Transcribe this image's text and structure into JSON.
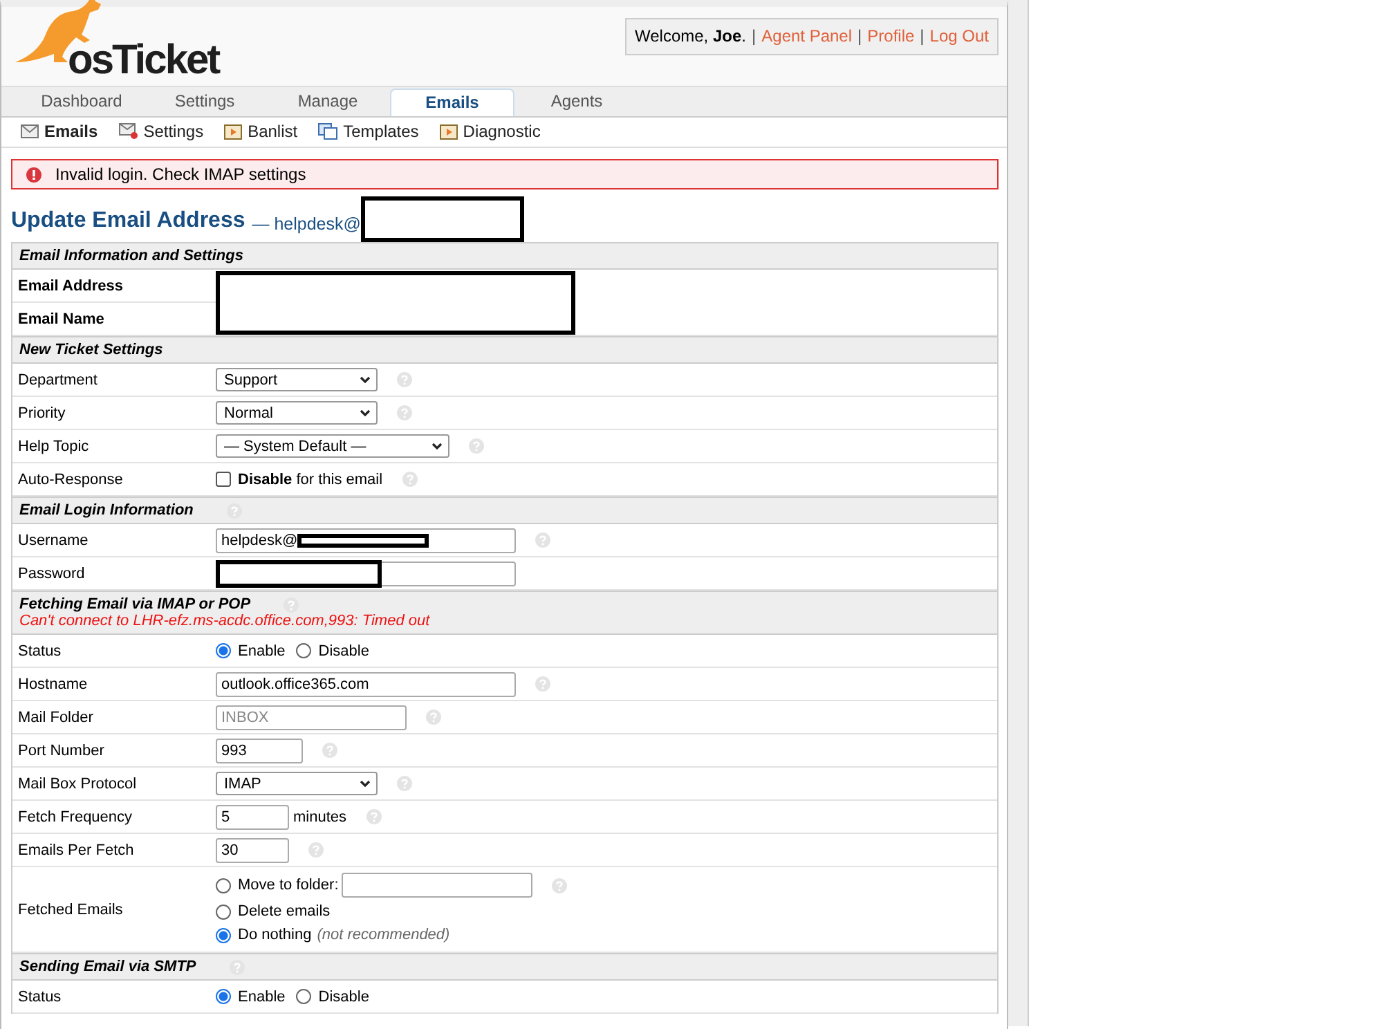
{
  "logo": {
    "text": "osTicket"
  },
  "user_bar": {
    "greeting": "Welcome, **Joe**.",
    "separator": "|",
    "links": [
      "Agent Panel",
      "Profile",
      "Log Out"
    ]
  },
  "tabs": [
    {
      "label": "Dashboard",
      "selected": false
    },
    {
      "label": "Settings",
      "selected": false
    },
    {
      "label": "Manage",
      "selected": false
    },
    {
      "label": "Emails",
      "selected": true
    },
    {
      "label": "Agents",
      "selected": false
    }
  ],
  "subnav": [
    {
      "label": "Emails",
      "selected": true
    },
    {
      "label": "Settings",
      "selected": false
    },
    {
      "label": "Banlist",
      "selected": false
    },
    {
      "label": "Templates",
      "selected": false
    },
    {
      "label": "Diagnostic",
      "selected": false
    }
  ],
  "alert": "Invalid login. Check IMAP settings",
  "page_title": {
    "title": "Update Email Address",
    "subtitle": "— helpdesk@",
    "redacted": true
  },
  "sections": [
    {
      "title": "Email Information and Settings",
      "help": false,
      "rows": [
        {
          "label": "Email Address",
          "bold": true,
          "control": {
            "kind": "redacted",
            "spans_next": true
          }
        },
        {
          "label": "Email Name",
          "bold": true
        }
      ]
    },
    {
      "title": "New Ticket Settings",
      "help": false,
      "rows": [
        {
          "label": "Department",
          "help": true,
          "control": {
            "kind": "select",
            "value": "Support"
          }
        },
        {
          "label": "Priority",
          "help": true,
          "control": {
            "kind": "select",
            "value": "Normal"
          }
        },
        {
          "label": "Help Topic",
          "help": true,
          "control": {
            "kind": "select",
            "value": "— System Default —"
          }
        },
        {
          "label": "Auto-Response",
          "help": true,
          "control": {
            "kind": "checkbox",
            "checked": false,
            "text": "**Disable** for this email"
          }
        }
      ]
    },
    {
      "title": "Email Login Information",
      "help": true,
      "rows": [
        {
          "label": "Username",
          "help": true,
          "control": {
            "kind": "text",
            "value": "helpdesk@",
            "redacted": true
          }
        },
        {
          "label": "Password",
          "help": false,
          "control": {
            "kind": "text",
            "redacted": true
          }
        }
      ]
    },
    {
      "title": "Fetching Email via IMAP or POP",
      "help": true,
      "error": "Can't connect to LHR-efz.ms-acdc.office.com,993: Timed out",
      "rows": [
        {
          "label": "Status",
          "help": false,
          "control": {
            "kind": "radio",
            "options": [
              {
                "label": "Enable",
                "selected": true
              },
              {
                "label": "Disable",
                "selected": false
              }
            ]
          }
        },
        {
          "label": "Hostname",
          "help": true,
          "control": {
            "kind": "text",
            "value": "outlook.office365.com"
          }
        },
        {
          "label": "Mail Folder",
          "help": true,
          "control": {
            "kind": "text",
            "placeholder": "INBOX"
          }
        },
        {
          "label": "Port Number",
          "help": true,
          "control": {
            "kind": "text",
            "value": "993"
          }
        },
        {
          "label": "Mail Box Protocol",
          "help": true,
          "control": {
            "kind": "select",
            "value": "IMAP"
          }
        },
        {
          "label": "Fetch Frequency",
          "help": true,
          "control": {
            "kind": "text",
            "value": "5",
            "suffix": "minutes"
          }
        },
        {
          "label": "Emails Per Fetch",
          "help": true,
          "control": {
            "kind": "text",
            "value": "30"
          }
        },
        {
          "label": "Fetched Emails",
          "help": true,
          "control": {
            "kind": "radiolist",
            "options": [
              {
                "label": "Move to folder:",
                "selected": false,
                "with_field": true
              },
              {
                "label": "Delete emails",
                "selected": false
              },
              {
                "label": "Do nothing",
                "note": "(not recommended)",
                "selected": true
              }
            ]
          }
        }
      ]
    },
    {
      "title": "Sending Email via SMTP",
      "help": true,
      "rows": [
        {
          "label": "Status",
          "help": false,
          "control": {
            "kind": "radio",
            "options": [
              {
                "label": "Enable",
                "selected": true
              },
              {
                "label": "Disable",
                "selected": false
              }
            ]
          }
        }
      ]
    }
  ]
}
